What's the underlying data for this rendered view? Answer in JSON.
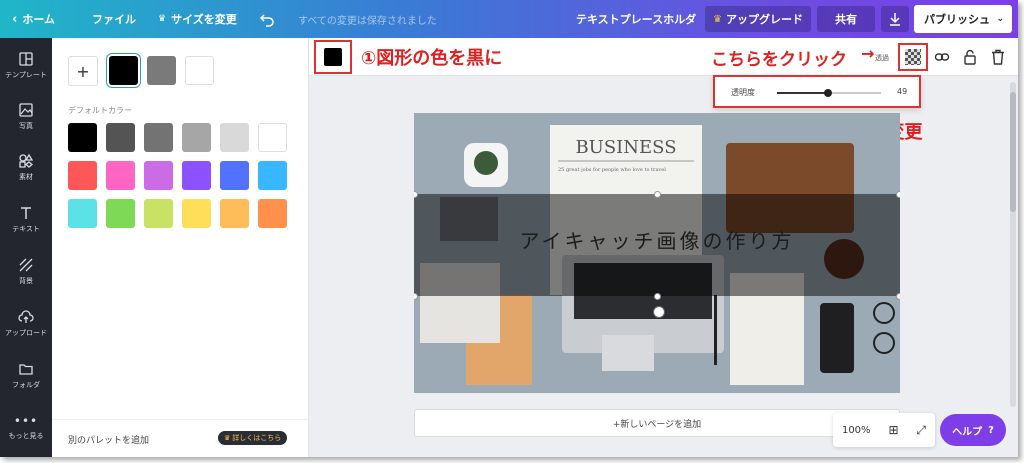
{
  "topbar": {
    "home": "ホーム",
    "file": "ファイル",
    "resize": "サイズを変更",
    "saved_status": "すべての変更は保存されました",
    "doc_title": "テキストプレースホルダ",
    "upgrade": "アップグレード",
    "share": "共有",
    "publish": "パブリッシュ"
  },
  "sidebar": {
    "items": [
      {
        "label": "テンプレート",
        "icon": "template-icon"
      },
      {
        "label": "写真",
        "icon": "photo-icon"
      },
      {
        "label": "素材",
        "icon": "elements-icon"
      },
      {
        "label": "テキスト",
        "icon": "text-icon"
      },
      {
        "label": "背景",
        "icon": "background-icon"
      },
      {
        "label": "アップロード",
        "icon": "upload-icon"
      },
      {
        "label": "フォルダ",
        "icon": "folder-icon"
      },
      {
        "label": "もっと見る",
        "icon": "more-icon"
      }
    ]
  },
  "color_panel": {
    "document_colors": [
      "#000000",
      "#7a7a7a",
      "#ffffff"
    ],
    "default_label": "デフォルトカラー",
    "default_colors": [
      "#000000",
      "#545454",
      "#737373",
      "#a6a6a6",
      "#d9d9d9",
      "#ffffff",
      "#ff5757",
      "#ff66c4",
      "#cb6ce6",
      "#8c52ff",
      "#5271ff",
      "#38b6ff",
      "#5ce1e6",
      "#7ed957",
      "#c9e265",
      "#ffde59",
      "#ffbd59",
      "#ff914d"
    ],
    "add_palette": "別のパレットを追加",
    "detail_badge": "詳しくはこちら"
  },
  "toolbar": {
    "selected_color": "#000000",
    "annotation_left": "①図形の色を黒に",
    "annotation_right": "こちらをクリック",
    "annotation_arrow": "→",
    "transparency_label": "透過"
  },
  "opacity": {
    "label": "透明度",
    "value": 49,
    "max": 100,
    "annotation": "② 透明度を変更"
  },
  "design": {
    "overlay_text": "アイキャッチ画像の作り方",
    "newspaper_headline": "BUSINESS",
    "newspaper_sub": "25 great jobs for people who love to travel"
  },
  "canvas": {
    "add_page": "+新しいページを追加",
    "zoom": "100%",
    "help": "ヘルプ",
    "help_q": "?"
  },
  "colors": {
    "accent": "#7d3ee8",
    "annotation": "#e02020"
  }
}
